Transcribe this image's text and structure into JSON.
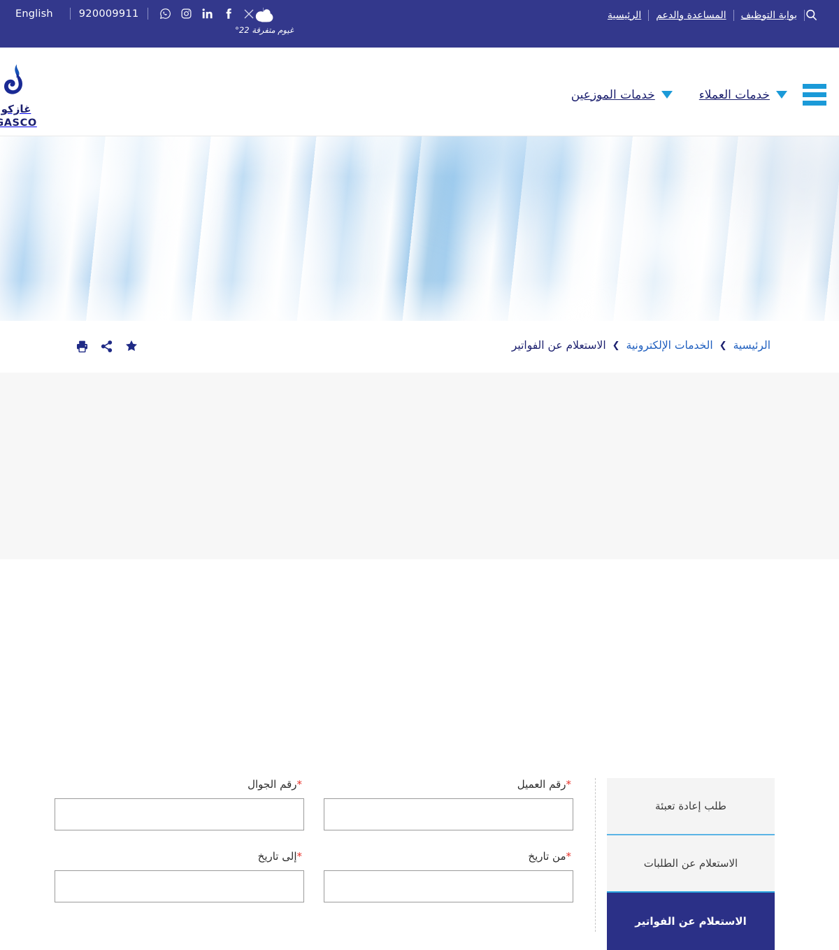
{
  "topbar": {
    "language_label": "English",
    "phone": "920009911",
    "social": [
      {
        "name": "whatsapp-icon",
        "label": "WhatsApp"
      },
      {
        "name": "instagram-icon",
        "label": "Instagram"
      },
      {
        "name": "linkedin-icon",
        "label": "LinkedIn"
      },
      {
        "name": "facebook-icon",
        "label": "Facebook"
      },
      {
        "name": "x-twitter-icon",
        "label": "X"
      }
    ],
    "weather": {
      "icon": "cloud-icon",
      "temperature": "22°",
      "condition": "غيوم متفرقة"
    },
    "links": [
      {
        "label": "بوابة التوظيف"
      },
      {
        "label": "المساعدة والدعم"
      },
      {
        "label": "الرئيسية"
      }
    ],
    "search_icon": "search-icon"
  },
  "header": {
    "logo": {
      "icon": "gasco-flame-logo",
      "arabic": "غازكو",
      "english": "GASCO"
    },
    "menu_icon": "hamburger-menu-icon",
    "nav": [
      {
        "label": "خدمات العملاء",
        "caret": "chevron-down-icon"
      },
      {
        "label": "خدمات الموزعين",
        "caret": "chevron-down-icon"
      }
    ]
  },
  "breadcrumb": {
    "items": [
      {
        "label": "الرئيسية",
        "current": false
      },
      {
        "label": "الخدمات الإلكترونية",
        "current": false
      },
      {
        "label": "الاستعلام عن الفواتير",
        "current": true
      }
    ],
    "separator": "❯",
    "tools": [
      {
        "name": "print-icon"
      },
      {
        "name": "share-icon"
      },
      {
        "name": "favorite-star-icon"
      }
    ]
  },
  "sidebar": {
    "tabs": [
      {
        "label": "طلب إعادة تعبئة",
        "active": false
      },
      {
        "label": "الاستعلام عن الطلبات",
        "active": false
      },
      {
        "label": "الاستعلام عن الفواتير",
        "active": true
      }
    ]
  },
  "form": {
    "required_mark": "*",
    "fields": [
      {
        "label": "رقم العميل",
        "value": "",
        "placeholder": "",
        "required": true
      },
      {
        "label": "رقم الجوال",
        "value": "",
        "placeholder": "",
        "required": true
      },
      {
        "label": "من تاريخ",
        "value": "",
        "placeholder": "",
        "required": true
      },
      {
        "label": "إلى تاريخ",
        "value": "",
        "placeholder": "",
        "required": true
      }
    ]
  },
  "colors": {
    "navy": "#33388c",
    "accent_blue": "#1b9ad8",
    "link_blue": "#1f5fbf",
    "required_red": "#e8322a",
    "active_tab": "#2b3087"
  }
}
